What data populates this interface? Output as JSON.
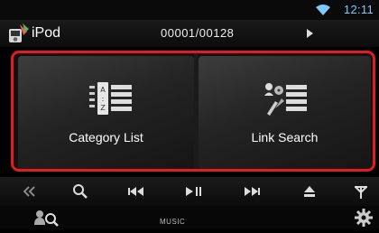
{
  "status": {
    "time": "12:11"
  },
  "header": {
    "source": "iPod",
    "track_counter": "00001/00128"
  },
  "tiles": [
    {
      "label": "Category List"
    },
    {
      "label": "Link Search"
    }
  ],
  "bottom": {
    "mode": "MUSIC"
  },
  "colors": {
    "highlight": "#e31b23",
    "clock": "#7fc8ff"
  }
}
